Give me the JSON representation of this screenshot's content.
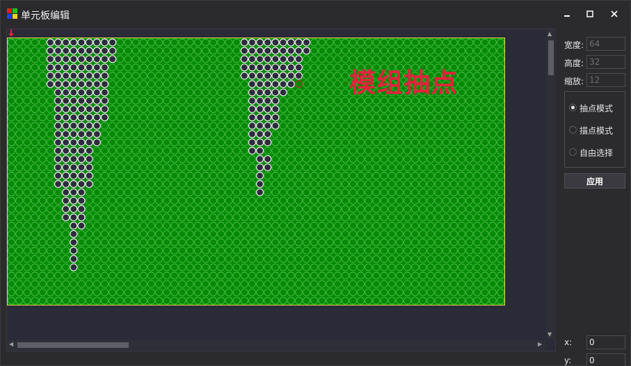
{
  "window": {
    "title": "单元板编辑",
    "min_icon": "minimize-icon",
    "max_icon": "maximize-icon",
    "close_icon": "close-icon"
  },
  "canvas": {
    "overlay_label": "模组抽点",
    "grid": {
      "cols": 64,
      "rows": 32,
      "colors": {
        "background": "#058a05",
        "ring": "#4dbb4d",
        "selected_fill": "#2c2c3c",
        "selected_ring": "#f0f0f0",
        "marker": "#e0243c",
        "border": "#e8e34a"
      }
    }
  },
  "side": {
    "width_label": "宽度:",
    "width_value": "64",
    "height_label": "高度:",
    "height_value": "32",
    "zoom_label": "缩放:",
    "zoom_value": "12",
    "modes": [
      {
        "label": "抽点模式",
        "selected": true
      },
      {
        "label": "描点模式",
        "selected": false
      },
      {
        "label": "自由选择",
        "selected": false
      }
    ],
    "apply_label": "应用",
    "x_label": "x:",
    "x_value": "0",
    "y_label": "y:",
    "y_value": "0"
  }
}
